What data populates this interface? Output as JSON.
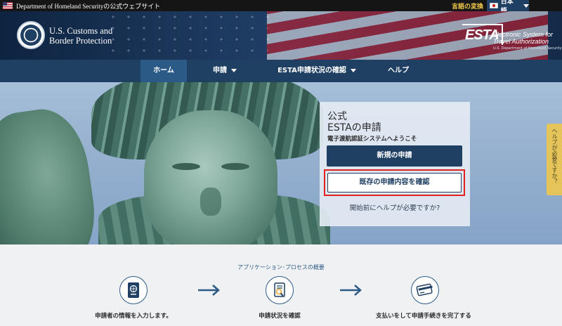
{
  "topbar": {
    "site_note": "Department of Homeland Securityの公式ウェブサイト",
    "language_change": "言語の変換",
    "language": "日本語"
  },
  "header": {
    "agency_line1": "U.S. Customs and",
    "agency_line2": "Border Protection",
    "esta_mark": "ESTA",
    "esta_full_line1": "Electronic System for",
    "esta_full_line2": "Travel Authorization",
    "dept": "U.S. Department of Homeland Security"
  },
  "nav": {
    "items": [
      {
        "label": "ホーム"
      },
      {
        "label": "申請"
      },
      {
        "label": "ESTA申請状況の確認"
      },
      {
        "label": "ヘルプ"
      }
    ]
  },
  "card": {
    "title_line1": "公式",
    "title_line2": "ESTAの申請",
    "subtitle": "電子渡航認証システムへようこそ",
    "new_application": "新規の申請",
    "existing_application": "既存の申請内容を確認",
    "help_link": "開始前にヘルプが必要ですか?"
  },
  "help_tab": "ヘルプが必要ですか？",
  "process": {
    "title": "アプリケーション･プロセスの概要",
    "steps": [
      {
        "label": "申請者の情報を入力します。",
        "icon": "passport-icon"
      },
      {
        "label": "申請状況を確認",
        "icon": "document-search-icon"
      },
      {
        "label": "支払いをして申請手続きを完了する",
        "icon": "credit-card-icon"
      }
    ]
  },
  "colors": {
    "navy": "#1f3f63",
    "nav_active": "#2b5a86",
    "highlight_red": "#e32020",
    "help_tab": "#e5c55a"
  }
}
